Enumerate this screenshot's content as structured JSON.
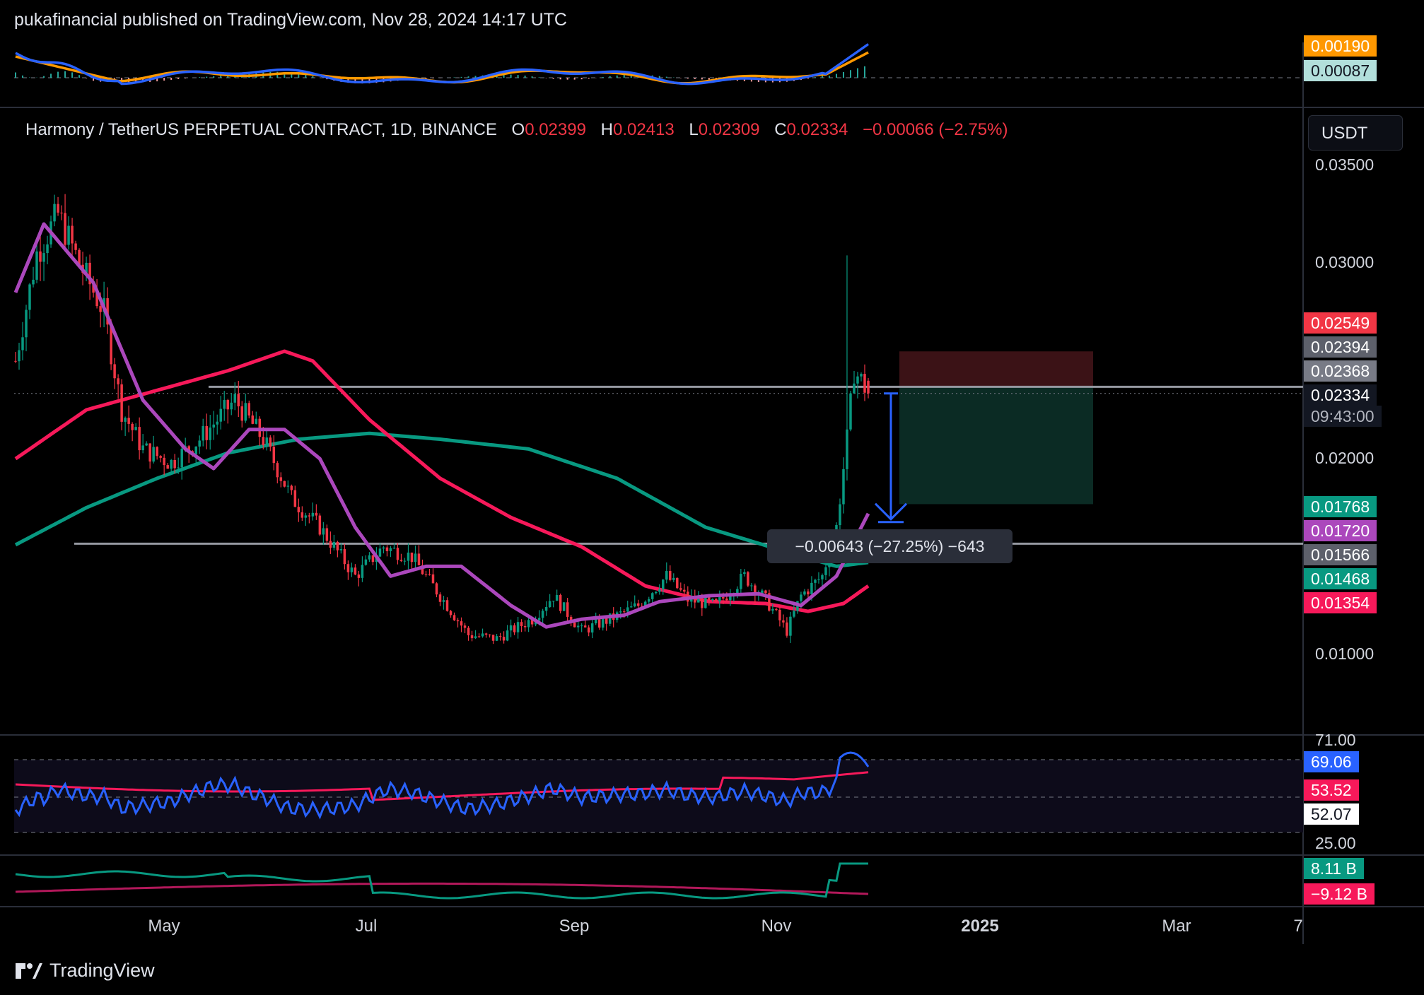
{
  "header": {
    "published_text": "pukafinancial published on TradingView.com, Nov 28, 2024 14:17 UTC"
  },
  "legend": {
    "symbol": "Harmony / TetherUS PERPETUAL CONTRACT, 1D, BINANCE",
    "o_label": "O",
    "o_value": "0.02399",
    "h_label": "H",
    "h_value": "0.02413",
    "l_label": "L",
    "l_value": "0.02309",
    "c_label": "C",
    "c_value": "0.02334",
    "change": "−0.00066 (−2.75%)"
  },
  "currency_button": "USDT",
  "price_axis": {
    "ticks": [
      "0.03500",
      "0.03000",
      "0.02000",
      "0.01000"
    ]
  },
  "price_badges": [
    {
      "text": "0.02549",
      "bg": "#f23645",
      "fg": "#ffffff"
    },
    {
      "text": "0.02394",
      "bg": "#5d606b",
      "fg": "#ffffff"
    },
    {
      "text": "0.02368",
      "bg": "#787b86",
      "fg": "#ffffff"
    },
    {
      "text": "0.02334",
      "bg": "#131722",
      "fg": "#ffffff"
    },
    {
      "text": "09:43:00",
      "bg": "#131722",
      "fg": "#b2b5be"
    },
    {
      "text": "0.01768",
      "bg": "#089981",
      "fg": "#ffffff"
    },
    {
      "text": "0.01720",
      "bg": "#ab47bc",
      "fg": "#ffffff"
    },
    {
      "text": "0.01566",
      "bg": "#5d606b",
      "fg": "#ffffff"
    },
    {
      "text": "0.01468",
      "bg": "#089981",
      "fg": "#ffffff"
    },
    {
      "text": "0.01354",
      "bg": "#f7195a",
      "fg": "#ffffff"
    }
  ],
  "top_pane_badges": [
    {
      "text": "0.00190",
      "bg": "#ff9800",
      "fg": "#ffffff"
    },
    {
      "text": "0.00087",
      "bg": "#b2dfdb",
      "fg": "#131722"
    }
  ],
  "rsi_pane": {
    "ticks": [
      "71.00",
      "25.00"
    ],
    "badges": [
      {
        "text": "69.06",
        "bg": "#2962ff",
        "fg": "#ffffff"
      },
      {
        "text": "53.52",
        "bg": "#f7195a",
        "fg": "#ffffff"
      },
      {
        "text": "52.07",
        "bg": "#ffffff",
        "fg": "#131722"
      }
    ]
  },
  "volume_pane": {
    "badges": [
      {
        "text": "8.11 B",
        "bg": "#089981",
        "fg": "#ffffff"
      },
      {
        "text": "−9.12 B",
        "bg": "#f7195a",
        "fg": "#ffffff"
      }
    ]
  },
  "time_axis": {
    "labels": [
      "May",
      "Jul",
      "Sep",
      "Nov",
      "2025",
      "Mar",
      "7"
    ]
  },
  "measure_label": "−0.00643 (−27.25%) −643",
  "footer": {
    "brand": "TradingView"
  },
  "colors": {
    "ma_purple": "#ab47bc",
    "ma_red": "#f7195a",
    "ma_green": "#089981",
    "rsi_line": "#2962ff",
    "up": "#089981",
    "down": "#f23645",
    "stop_zone": "#3b1216",
    "target_zone": "#0b2b24"
  },
  "chart_data": {
    "type": "candlestick",
    "title": "Harmony / TetherUS PERPETUAL CONTRACT, 1D, BINANCE",
    "last_close": 0.02334,
    "ylim": [
      0.0068,
      0.0368
    ],
    "horizontal_levels": [
      0.02368,
      0.01566
    ],
    "moving_averages": [
      {
        "name": "MA purple",
        "value": 0.0172,
        "color": "#ab47bc"
      },
      {
        "name": "MA red",
        "value": 0.01354,
        "color": "#f7195a"
      },
      {
        "name": "MA green",
        "value": 0.01468,
        "color": "#089981"
      }
    ],
    "position_tool": {
      "entry": 0.02368,
      "stop": 0.02549,
      "target": 0.01768
    },
    "measure": {
      "from": 0.02334,
      "to": 0.01691,
      "change": "−0.00643 (−27.25%) −643"
    },
    "price_waypoints": [
      {
        "t": 0,
        "p": 0.025
      },
      {
        "t": 6,
        "p": 0.0305
      },
      {
        "t": 12,
        "p": 0.0325
      },
      {
        "t": 18,
        "p": 0.03
      },
      {
        "t": 25,
        "p": 0.0275
      },
      {
        "t": 30,
        "p": 0.0225
      },
      {
        "t": 36,
        "p": 0.0205
      },
      {
        "t": 44,
        "p": 0.0198
      },
      {
        "t": 52,
        "p": 0.021
      },
      {
        "t": 62,
        "p": 0.023
      },
      {
        "t": 70,
        "p": 0.021
      },
      {
        "t": 78,
        "p": 0.018
      },
      {
        "t": 86,
        "p": 0.0165
      },
      {
        "t": 96,
        "p": 0.014
      },
      {
        "t": 104,
        "p": 0.0155
      },
      {
        "t": 112,
        "p": 0.015
      },
      {
        "t": 120,
        "p": 0.013
      },
      {
        "t": 128,
        "p": 0.011
      },
      {
        "t": 136,
        "p": 0.0108
      },
      {
        "t": 146,
        "p": 0.0118
      },
      {
        "t": 152,
        "p": 0.013
      },
      {
        "t": 160,
        "p": 0.0112
      },
      {
        "t": 168,
        "p": 0.0118
      },
      {
        "t": 176,
        "p": 0.0125
      },
      {
        "t": 184,
        "p": 0.014
      },
      {
        "t": 190,
        "p": 0.0128
      },
      {
        "t": 198,
        "p": 0.0125
      },
      {
        "t": 206,
        "p": 0.014
      },
      {
        "t": 212,
        "p": 0.0128
      },
      {
        "t": 218,
        "p": 0.0112
      },
      {
        "t": 222,
        "p": 0.013
      },
      {
        "t": 228,
        "p": 0.014
      },
      {
        "t": 232,
        "p": 0.0165
      },
      {
        "t": 235,
        "p": 0.021
      },
      {
        "t": 237,
        "p": 0.0245
      },
      {
        "t": 239,
        "p": 0.024
      },
      {
        "t": 241,
        "p": 0.0233
      }
    ],
    "moving_average_waypoints": {
      "purple": [
        {
          "t": 0,
          "p": 0.0285
        },
        {
          "t": 8,
          "p": 0.032
        },
        {
          "t": 22,
          "p": 0.029
        },
        {
          "t": 36,
          "p": 0.023
        },
        {
          "t": 48,
          "p": 0.0205
        },
        {
          "t": 56,
          "p": 0.0195
        },
        {
          "t": 66,
          "p": 0.0215
        },
        {
          "t": 76,
          "p": 0.0215
        },
        {
          "t": 86,
          "p": 0.02
        },
        {
          "t": 96,
          "p": 0.0165
        },
        {
          "t": 106,
          "p": 0.014
        },
        {
          "t": 116,
          "p": 0.0145
        },
        {
          "t": 126,
          "p": 0.0145
        },
        {
          "t": 140,
          "p": 0.0125
        },
        {
          "t": 150,
          "p": 0.0114
        },
        {
          "t": 160,
          "p": 0.0118
        },
        {
          "t": 172,
          "p": 0.012
        },
        {
          "t": 182,
          "p": 0.0127
        },
        {
          "t": 196,
          "p": 0.013
        },
        {
          "t": 210,
          "p": 0.0131
        },
        {
          "t": 222,
          "p": 0.0125
        },
        {
          "t": 232,
          "p": 0.014
        },
        {
          "t": 241,
          "p": 0.0172
        }
      ],
      "red": [
        {
          "t": 0,
          "p": 0.02
        },
        {
          "t": 20,
          "p": 0.0225
        },
        {
          "t": 40,
          "p": 0.0235
        },
        {
          "t": 60,
          "p": 0.0245
        },
        {
          "t": 76,
          "p": 0.0255
        },
        {
          "t": 84,
          "p": 0.025
        },
        {
          "t": 100,
          "p": 0.022
        },
        {
          "t": 120,
          "p": 0.019
        },
        {
          "t": 140,
          "p": 0.017
        },
        {
          "t": 160,
          "p": 0.0155
        },
        {
          "t": 178,
          "p": 0.0135
        },
        {
          "t": 196,
          "p": 0.0127
        },
        {
          "t": 212,
          "p": 0.0126
        },
        {
          "t": 224,
          "p": 0.0122
        },
        {
          "t": 234,
          "p": 0.0126
        },
        {
          "t": 241,
          "p": 0.0135
        }
      ],
      "green": [
        {
          "t": 0,
          "p": 0.0156
        },
        {
          "t": 20,
          "p": 0.0175
        },
        {
          "t": 40,
          "p": 0.019
        },
        {
          "t": 60,
          "p": 0.0203
        },
        {
          "t": 80,
          "p": 0.021
        },
        {
          "t": 100,
          "p": 0.0213
        },
        {
          "t": 120,
          "p": 0.021
        },
        {
          "t": 145,
          "p": 0.0205
        },
        {
          "t": 170,
          "p": 0.019
        },
        {
          "t": 195,
          "p": 0.0165
        },
        {
          "t": 215,
          "p": 0.0154
        },
        {
          "t": 232,
          "p": 0.0145
        },
        {
          "t": 241,
          "p": 0.0147
        }
      ]
    },
    "bars_total": 242,
    "rsi": {
      "value": 69.06,
      "ma": 53.52,
      "levels": [
        71,
        52.07,
        25
      ]
    },
    "volume_osc": {
      "value": "8.11 B",
      "ma": "−9.12 B"
    }
  }
}
